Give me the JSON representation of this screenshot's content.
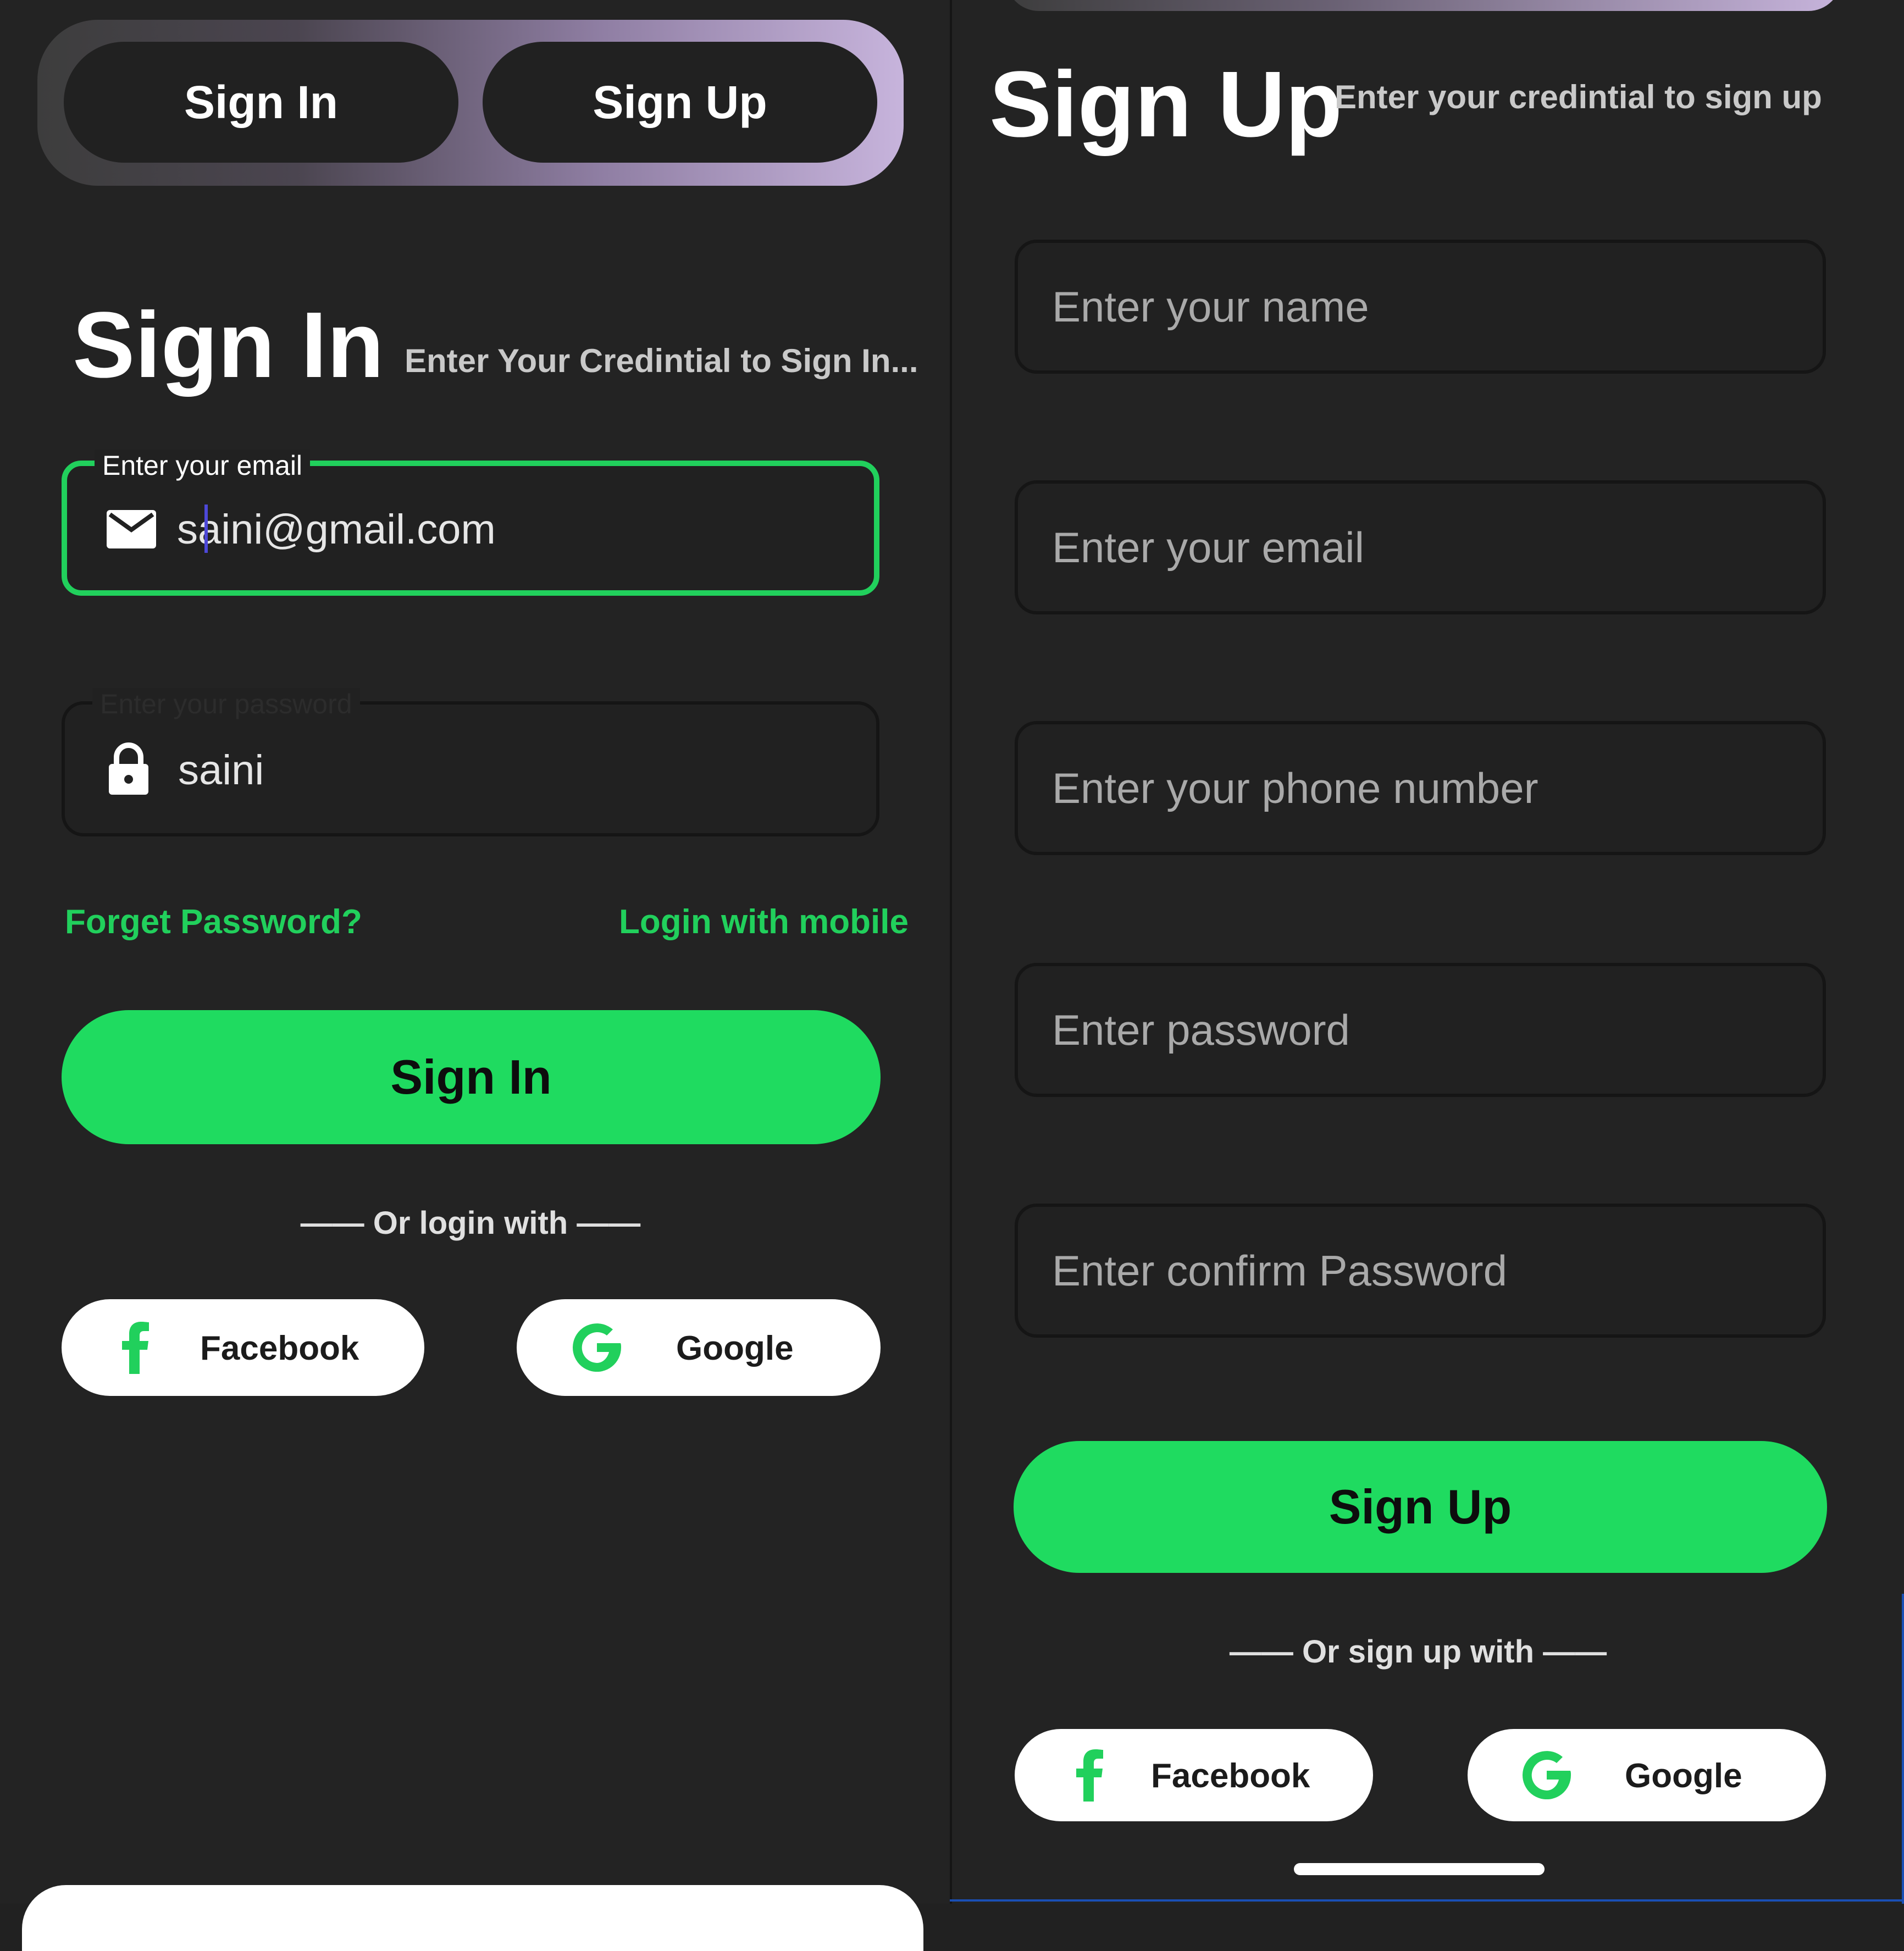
{
  "toggle": {
    "sign_in_label": "Sign In",
    "sign_up_label": "Sign Up"
  },
  "signin": {
    "title": "Sign In",
    "subtitle": "Enter Your Credintial to Sign In...",
    "email": {
      "label": "Enter your email",
      "value": "saini@gmail.com",
      "icon": "mail-icon"
    },
    "password": {
      "label": "Enter your password",
      "value": "saini",
      "icon": "lock-icon"
    },
    "forgot_password": "Forget Password?",
    "login_mobile": "Login with mobile",
    "button_label": "Sign In",
    "divider": "—— Or login with ——",
    "facebook_label": "Facebook",
    "google_label": "Google"
  },
  "signup": {
    "title": "Sign Up",
    "subtitle": "Enter your credintial to sign up",
    "fields": [
      {
        "placeholder": "Enter your name"
      },
      {
        "placeholder": "Enter your email"
      },
      {
        "placeholder": "Enter your phone number"
      },
      {
        "placeholder": "Enter password"
      },
      {
        "placeholder": "Enter confirm Password"
      }
    ],
    "button_label": "Sign Up",
    "divider": "—— Or sign up with ——",
    "facebook_label": "Facebook",
    "google_label": "Google"
  },
  "colors": {
    "background": "#232323",
    "accent_green": "#1fdb60",
    "focus_border": "#21d05c",
    "toggle_gradient_end": "#c7b4dc",
    "facebook_icon": "#21d05c",
    "google_icon": "#21d05c"
  }
}
